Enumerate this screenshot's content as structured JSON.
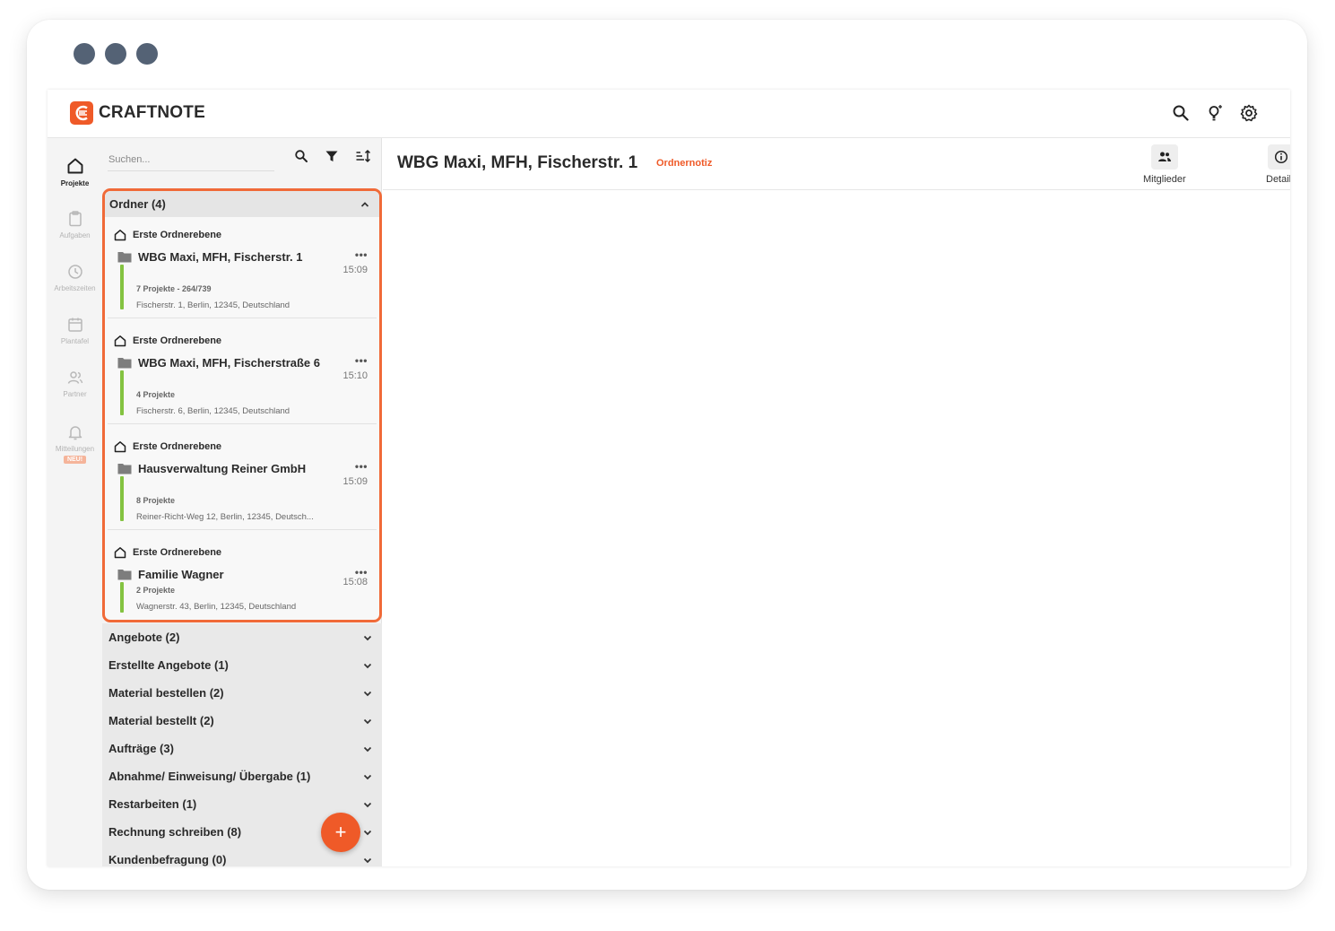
{
  "app": {
    "name": "CRAFTNOTE",
    "brand_color": "#ef5a28",
    "accent_green": "#84c341"
  },
  "rail": [
    {
      "label": "Projekte",
      "icon": "home-icon",
      "active": true
    },
    {
      "label": "Aufgaben",
      "icon": "clipboard-icon"
    },
    {
      "label": "Arbeitszeiten",
      "icon": "clock-icon"
    },
    {
      "label": "Plantafel",
      "icon": "calendar-icon"
    },
    {
      "label": "Partner",
      "icon": "people-icon"
    },
    {
      "label": "Mitteilungen",
      "icon": "bell-icon",
      "badge": "NEU!"
    }
  ],
  "search": {
    "placeholder": "Suchen..."
  },
  "ordner": {
    "title": "Ordner (4)",
    "items": [
      {
        "level": "Erste Ordnerebene",
        "name": "WBG Maxi, MFH, Fischerstr. 1",
        "time": "15:09",
        "projects": "7 Projekte - 264/739",
        "address": "Fischerstr. 1, Berlin, 12345, Deutschland"
      },
      {
        "level": "Erste Ordnerebene",
        "name": "WBG Maxi, MFH, Fischerstraße 6",
        "time": "15:10",
        "projects": "4 Projekte",
        "address": "Fischerstr. 6, Berlin, 12345, Deutschland"
      },
      {
        "level": "Erste Ordnerebene",
        "name": "Hausverwaltung Reiner GmbH",
        "time": "15:09",
        "projects": "8 Projekte",
        "address": "Reiner-Richt-Weg 12, Berlin, 12345, Deutsch..."
      },
      {
        "level": "Erste Ordnerebene",
        "name": "Familie Wagner",
        "time": "15:08",
        "projects": "2 Projekte",
        "address": "Wagnerstr. 43, Berlin, 12345, Deutschland"
      }
    ]
  },
  "groups": [
    "Angebote (2)",
    "Erstellte Angebote (1)",
    "Material bestellen (2)",
    "Material bestellt (2)",
    "Aufträge (3)",
    "Abnahme/ Einweisung/ Übergabe (1)",
    "Restarbeiten (1)",
    "Rechnung schreiben (8)",
    "Kundenbefragung (0)"
  ],
  "fab": {
    "label": "+"
  },
  "main": {
    "title": "WBG Maxi, MFH, Fischerstr. 1",
    "note": "Ordnernotiz",
    "members_label": "Mitglieder",
    "details_label": "Details"
  }
}
